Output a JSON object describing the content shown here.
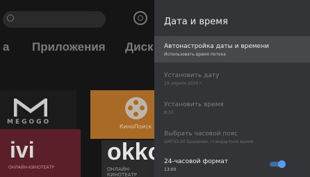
{
  "background": {
    "nav": {
      "prev": "а",
      "apps": "Приложения",
      "next": "Диск"
    },
    "tiles": {
      "megogo": "MEGOGO",
      "kinopoisk": "КиноПоиск",
      "ivi": "ivi",
      "ivi_sub": "ОНЛАЙН-КИНОТЕАТР",
      "okko": "okko",
      "okko_sub": "ОНЛАЙН-КИНОТЕАТР"
    }
  },
  "panel": {
    "title": "Дата и время",
    "items": [
      {
        "title": "Автонастройка даты и времени",
        "subtitle": "Использовать время потока",
        "state": "focused"
      },
      {
        "title": "Установить дату",
        "subtitle": "29 апреля 2020 г.",
        "state": "disabled"
      },
      {
        "title": "Установить время",
        "subtitle": "8:10",
        "state": "disabled"
      },
      {
        "title": "Выбрать часовой пояс",
        "subtitle": "GMT03:00 Бразилия, стандартное время",
        "state": "disabled"
      },
      {
        "title": "24-часовой формат",
        "subtitle": "13:00",
        "state": "enabled",
        "toggle": "on"
      }
    ]
  },
  "colors": {
    "panel_bg": "#333438",
    "focus_bg": "#47484c",
    "toggle_on": "#5a9cf0"
  }
}
